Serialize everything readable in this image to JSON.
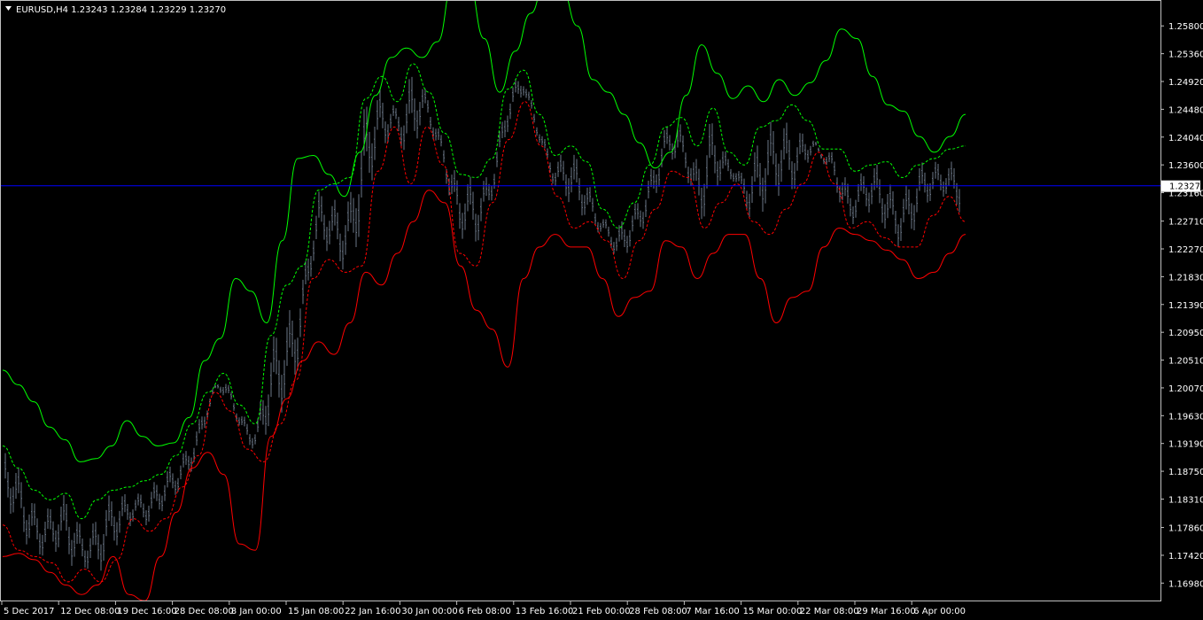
{
  "header": {
    "symbol_line": "EURUSD,H4  1.23243 1.23284 1.23229 1.23270"
  },
  "chart_data": {
    "type": "line",
    "title": "EURUSD,H4",
    "ohlc_last": {
      "open": 1.23243,
      "high": 1.23284,
      "low": 1.23229,
      "close": 1.2327
    },
    "current_price": 1.2327,
    "current_price_label": "1.23270",
    "ylim": [
      1.1669,
      1.2621
    ],
    "y_ticks": [
      "1.25800",
      "1.25360",
      "1.24920",
      "1.24480",
      "1.24040",
      "1.23600",
      "1.23160",
      "1.22710",
      "1.22270",
      "1.21830",
      "1.21390",
      "1.20950",
      "1.20510",
      "1.20070",
      "1.19630",
      "1.19190",
      "1.18750",
      "1.18310",
      "1.17860",
      "1.17420",
      "1.16980"
    ],
    "x_ticks": [
      "5 Dec 2017",
      "12 Dec 08:00",
      "19 Dec 16:00",
      "28 Dec 08:00",
      "8 Jan 00:00",
      "15 Jan 08:00",
      "22 Jan 16:00",
      "30 Jan 00:00",
      "6 Feb 08:00",
      "13 Feb 16:00",
      "21 Feb 00:00",
      "28 Feb 08:00",
      "7 Mar 16:00",
      "15 Mar 00:00",
      "22 Mar 08:00",
      "29 Mar 16:00",
      "6 Apr 00:00"
    ],
    "colors": {
      "background": "#000000",
      "grid": "#000000",
      "axis": "#c0c0c0",
      "bars": "#6c7787",
      "upper_band": "#00ff00",
      "lower_band": "#ff0000",
      "current_price_line": "#0000ff",
      "price_tag": "#ffffff"
    },
    "series": [
      {
        "style": "solid",
        "color": "#00ff00",
        "values": [
          1.2035,
          1.2012,
          1.1985,
          1.1945,
          1.1925,
          1.189,
          1.1895,
          1.1915,
          1.1955,
          1.193,
          1.1915,
          1.192,
          1.196,
          1.205,
          1.2085,
          1.218,
          1.216,
          1.211,
          1.224,
          1.237,
          1.2375,
          1.2345,
          1.231,
          1.238,
          1.247,
          1.253,
          1.2545,
          1.253,
          1.2555,
          1.265,
          1.265,
          1.256,
          1.2475,
          1.254,
          1.26,
          1.266,
          1.264,
          1.258,
          1.2495,
          1.2475,
          1.244,
          1.2395,
          1.2355,
          1.238,
          1.247,
          1.255,
          1.2505,
          1.2465,
          1.2485,
          1.246,
          1.2495,
          1.247,
          1.249,
          1.2525,
          1.2575,
          1.256,
          1.25,
          1.2455,
          1.2445,
          1.2405,
          1.238,
          1.2405,
          1.244
        ]
      },
      {
        "style": "dashed",
        "color": "#00ff00",
        "values": [
          1.1915,
          1.188,
          1.1845,
          1.183,
          1.184,
          1.18,
          1.183,
          1.1845,
          1.185,
          1.186,
          1.187,
          1.19,
          1.195,
          1.2,
          1.203,
          1.198,
          1.195,
          1.209,
          1.217,
          1.22,
          1.232,
          1.233,
          1.234,
          1.2465,
          1.25,
          1.246,
          1.252,
          1.2475,
          1.241,
          1.2345,
          1.234,
          1.237,
          1.248,
          1.251,
          1.244,
          1.2375,
          1.239,
          1.2365,
          1.229,
          1.226,
          1.23,
          1.236,
          1.242,
          1.2435,
          1.239,
          1.245,
          1.238,
          1.236,
          1.242,
          1.243,
          1.2455,
          1.243,
          1.2385,
          1.2385,
          1.235,
          1.236,
          1.2365,
          1.234,
          1.236,
          1.237,
          1.2385,
          1.239
        ]
      },
      {
        "style": "dashed",
        "color": "#ff0000",
        "values": [
          1.179,
          1.175,
          1.174,
          1.173,
          1.17,
          1.172,
          1.17,
          1.1735,
          1.18,
          1.178,
          1.18,
          1.185,
          1.19,
          1.2,
          1.197,
          1.191,
          1.189,
          1.195,
          1.202,
          1.218,
          1.221,
          1.219,
          1.22,
          1.235,
          1.242,
          1.233,
          1.242,
          1.236,
          1.222,
          1.22,
          1.23,
          1.24,
          1.246,
          1.239,
          1.231,
          1.226,
          1.227,
          1.224,
          1.218,
          1.224,
          1.229,
          1.235,
          1.234,
          1.226,
          1.23,
          1.233,
          1.227,
          1.225,
          1.229,
          1.233,
          1.238,
          1.233,
          1.226,
          1.227,
          1.2245,
          1.223,
          1.223,
          1.228,
          1.231,
          1.227
        ]
      },
      {
        "style": "solid",
        "color": "#ff0000",
        "values": [
          1.174,
          1.1745,
          1.1735,
          1.1715,
          1.1695,
          1.168,
          1.1695,
          1.174,
          1.168,
          1.167,
          1.174,
          1.181,
          1.188,
          1.1905,
          1.187,
          1.176,
          1.175,
          1.193,
          1.199,
          1.205,
          1.208,
          1.206,
          1.211,
          1.219,
          1.217,
          1.222,
          1.227,
          1.232,
          1.23,
          1.22,
          1.213,
          1.21,
          1.204,
          1.218,
          1.223,
          1.225,
          1.223,
          1.223,
          1.218,
          1.212,
          1.215,
          1.216,
          1.224,
          1.223,
          1.218,
          1.222,
          1.225,
          1.225,
          1.218,
          1.211,
          1.215,
          1.216,
          1.223,
          1.226,
          1.225,
          1.224,
          1.2225,
          1.221,
          1.218,
          1.219,
          1.222,
          1.225
        ]
      }
    ]
  }
}
